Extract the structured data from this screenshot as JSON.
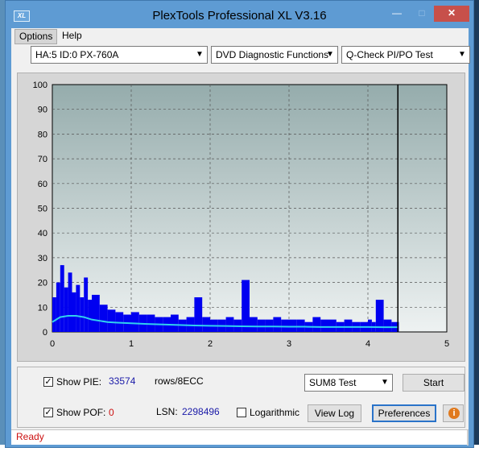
{
  "window": {
    "title": "PlexTools Professional XL V3.16",
    "icon_text": "XL",
    "controls": [
      "minimize",
      "maximize",
      "close"
    ]
  },
  "menu": {
    "items": [
      "Options",
      "Help"
    ]
  },
  "toolbar": {
    "drive": "HA:5 ID:0  PX-760A",
    "function": "DVD Diagnostic Functions",
    "test": "Q-Check PI/PO Test"
  },
  "chart_data": {
    "type": "bar",
    "title": "",
    "xlabel": "",
    "ylabel": "",
    "xlim": [
      0,
      5
    ],
    "ylim": [
      0,
      100
    ],
    "x_ticks": [
      0,
      1,
      2,
      3,
      4,
      5
    ],
    "y_ticks": [
      0,
      10,
      20,
      30,
      40,
      50,
      60,
      70,
      80,
      90,
      100
    ],
    "grid": true,
    "end_marker_x": 4.38,
    "colors": {
      "pie_bars": "#0000f0",
      "sum_line": "#30d0ee",
      "plot_bg_top": "#95acac",
      "plot_bg_bottom": "#eef2f2"
    },
    "series": [
      {
        "name": "PIE",
        "x": [
          0.0,
          0.05,
          0.1,
          0.15,
          0.2,
          0.25,
          0.3,
          0.35,
          0.4,
          0.45,
          0.5,
          0.6,
          0.7,
          0.8,
          0.9,
          1.0,
          1.1,
          1.2,
          1.3,
          1.4,
          1.5,
          1.6,
          1.7,
          1.8,
          1.9,
          2.0,
          2.1,
          2.2,
          2.3,
          2.4,
          2.5,
          2.6,
          2.7,
          2.8,
          2.9,
          3.0,
          3.1,
          3.2,
          3.3,
          3.4,
          3.5,
          3.6,
          3.7,
          3.8,
          3.9,
          4.0,
          4.05,
          4.1,
          4.2,
          4.3,
          4.38
        ],
        "values": [
          14,
          20,
          27,
          18,
          24,
          16,
          19,
          14,
          22,
          13,
          15,
          11,
          9,
          8,
          7,
          8,
          7,
          7,
          6,
          6,
          7,
          5,
          6,
          14,
          6,
          5,
          5,
          6,
          5,
          21,
          6,
          5,
          5,
          6,
          5,
          5,
          5,
          4,
          6,
          5,
          5,
          4,
          5,
          4,
          4,
          5,
          4,
          13,
          5,
          4,
          4
        ]
      },
      {
        "name": "SUM8",
        "x": [
          0.0,
          0.05,
          0.1,
          0.2,
          0.3,
          0.4,
          0.5,
          0.6,
          0.7,
          0.8,
          1.0,
          1.2,
          1.4,
          1.6,
          1.8,
          2.0,
          2.2,
          2.4,
          2.6,
          2.8,
          3.0,
          3.2,
          3.4,
          3.6,
          3.8,
          4.0,
          4.2,
          4.38
        ],
        "values": [
          4,
          5,
          6,
          6.5,
          6.5,
          6,
          5,
          4.5,
          4,
          3.8,
          3.5,
          3.2,
          3,
          2.8,
          2.6,
          2.5,
          2.4,
          2.3,
          2.2,
          2.2,
          2.1,
          2.1,
          2,
          2,
          2,
          2,
          1.9,
          1.9
        ]
      }
    ]
  },
  "bottom_panel": {
    "show_pie_label": "Show PIE:",
    "pie_value": "33574",
    "unit": "rows/8ECC",
    "show_poe_label": "Show POF:",
    "poe_value": "0",
    "lsn_label": "LSN:",
    "lsn_value": "2298496",
    "log_label": "Logarithmic",
    "sum_test": "SUM8 Test",
    "start": "Start",
    "view_log": "View Log",
    "preferences": "Preferences"
  },
  "status": {
    "text": "Ready"
  }
}
